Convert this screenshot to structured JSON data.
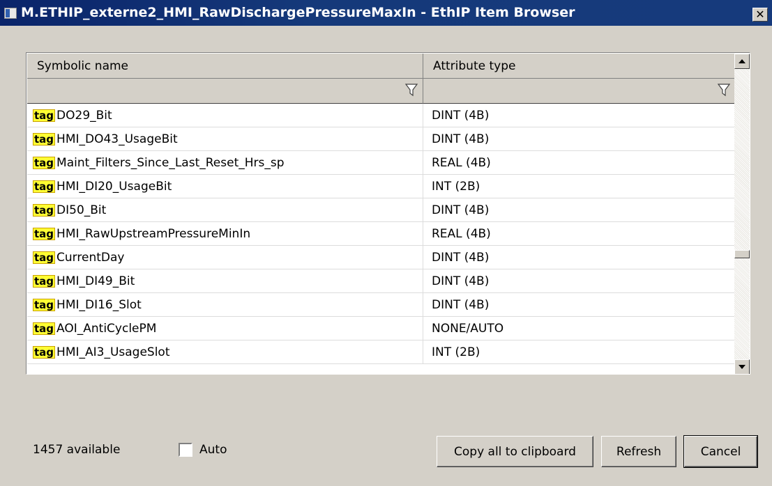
{
  "window": {
    "title": "M.ETHIP_externe2_HMI_RawDischargePressureMaxIn - EthIP Item Browser",
    "close_glyph": "✕"
  },
  "grid": {
    "columns": [
      "Symbolic name",
      "Attribute type"
    ],
    "tag_label": "tag",
    "rows": [
      {
        "name": "DO29_Bit",
        "type": "DINT (4B)"
      },
      {
        "name": "HMI_DO43_UsageBit",
        "type": "DINT (4B)"
      },
      {
        "name": "Maint_Filters_Since_Last_Reset_Hrs_sp",
        "type": "REAL (4B)"
      },
      {
        "name": "HMI_DI20_UsageBit",
        "type": "INT (2B)"
      },
      {
        "name": "DI50_Bit",
        "type": "DINT (4B)"
      },
      {
        "name": "HMI_RawUpstreamPressureMinIn",
        "type": "REAL (4B)"
      },
      {
        "name": "CurrentDay",
        "type": "DINT (4B)"
      },
      {
        "name": "HMI_DI49_Bit",
        "type": "DINT (4B)"
      },
      {
        "name": "HMI_DI16_Slot",
        "type": "DINT (4B)"
      },
      {
        "name": "AOI_AntiCyclePM",
        "type": "NONE/AUTO"
      },
      {
        "name": "HMI_AI3_UsageSlot",
        "type": "INT (2B)"
      }
    ]
  },
  "footer": {
    "available": "1457 available",
    "auto_label": "Auto",
    "auto_checked": false,
    "copy_label": "Copy all to clipboard",
    "refresh_label": "Refresh",
    "cancel_label": "Cancel"
  },
  "colors": {
    "title_bar": "#0a246a",
    "tag_badge": "#ffff33",
    "dialog_bg": "#d4d0c8"
  }
}
